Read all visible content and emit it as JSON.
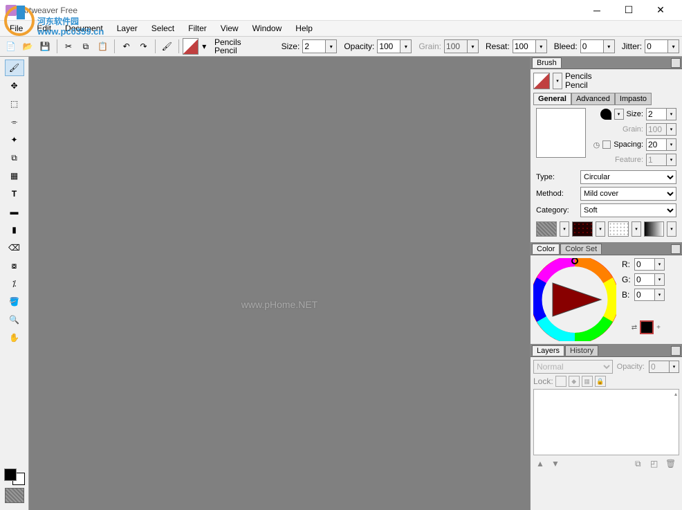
{
  "title": "Artweaver Free",
  "menu": [
    "File",
    "Edit",
    "Document",
    "Layer",
    "Select",
    "Filter",
    "View",
    "Window",
    "Help"
  ],
  "toolbar": {
    "brush_category": "Pencils",
    "brush_name": "Pencil",
    "size_label": "Size:",
    "size_value": "2",
    "opacity_label": "Opacity:",
    "opacity_value": "100",
    "grain_label": "Grain:",
    "grain_value": "100",
    "resat_label": "Resat:",
    "resat_value": "100",
    "bleed_label": "Bleed:",
    "bleed_value": "0",
    "jitter_label": "Jitter:",
    "jitter_value": "0"
  },
  "panels": {
    "brush": {
      "title": "Brush",
      "category": "Pencils",
      "name": "Pencil",
      "tabs": [
        "General",
        "Advanced",
        "Impasto"
      ],
      "size_label": "Size:",
      "size_value": "2",
      "grain_label": "Grain:",
      "grain_value": "100",
      "spacing_label": "Spacing:",
      "spacing_value": "20",
      "feature_label": "Feature:",
      "feature_value": "1",
      "type_label": "Type:",
      "type_value": "Circular",
      "method_label": "Method:",
      "method_value": "Mild cover",
      "category_label": "Category:",
      "category_value": "Soft"
    },
    "color": {
      "tabs": [
        "Color",
        "Color Set"
      ],
      "r_label": "R:",
      "r_value": "0",
      "g_label": "G:",
      "g_value": "0",
      "b_label": "B:",
      "b_value": "0"
    },
    "layers": {
      "tabs": [
        "Layers",
        "History"
      ],
      "blend_mode": "Normal",
      "opacity_label": "Opacity:",
      "opacity_value": "0",
      "lock_label": "Lock:"
    }
  },
  "watermark": {
    "text": "河东软件园",
    "url": "www.pc0359.cn",
    "canvas": "www.pHome.NET"
  }
}
